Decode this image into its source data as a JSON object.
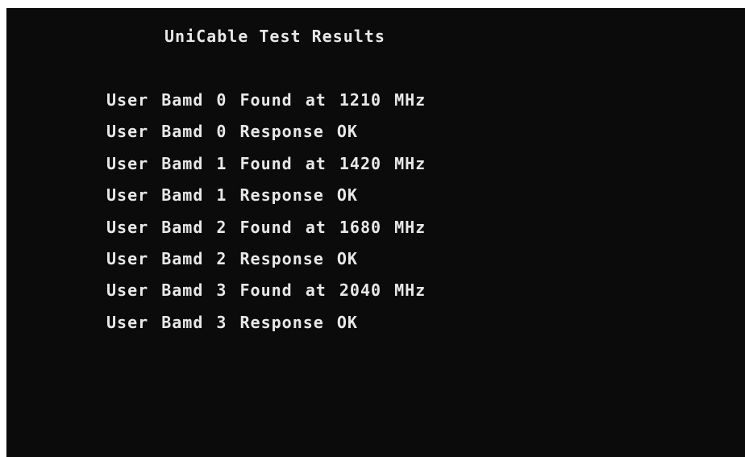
{
  "screen": {
    "title": "UniCable Test Results",
    "lines": [
      "User Bamd 0 Found at 1210 MHz",
      "User Bamd 0 Response OK",
      "User Bamd 1 Found at 1420 MHz",
      "User Bamd 1 Response OK",
      "User Bamd 2 Found at 1680 MHz",
      "User Bamd 2 Response OK",
      "User Bamd 3 Found at 2040 MHz",
      "User Bamd 3 Response OK"
    ]
  },
  "colors": {
    "background": "#0b0b0b",
    "text": "#e8e8e8"
  }
}
